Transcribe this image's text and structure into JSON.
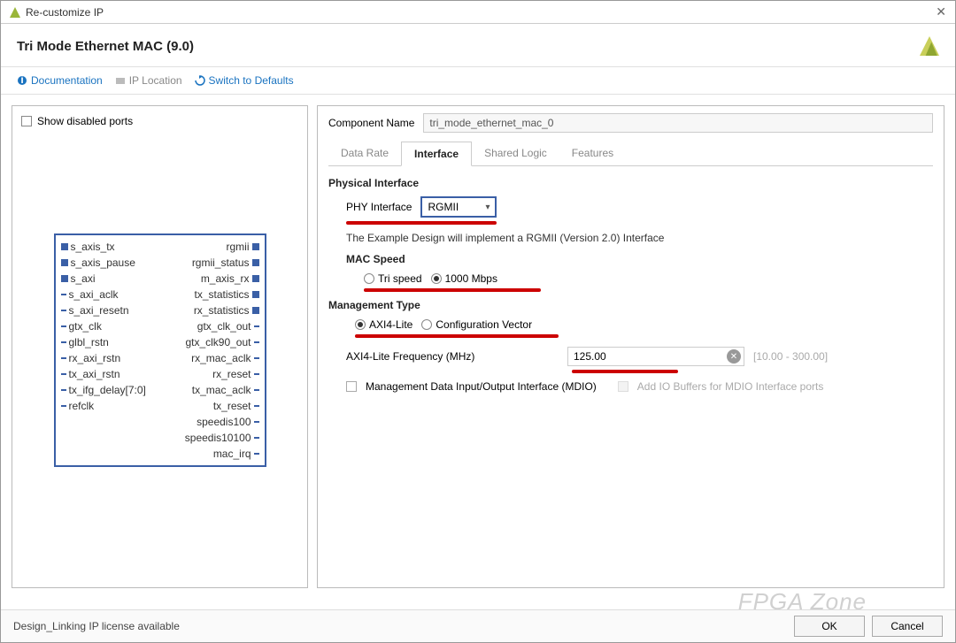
{
  "window": {
    "title": "Re-customize IP"
  },
  "ip": {
    "title": "Tri Mode Ethernet MAC (9.0)"
  },
  "toolbar": {
    "doc": "Documentation",
    "loc": "IP Location",
    "defaults": "Switch to Defaults"
  },
  "left": {
    "show_disabled": "Show disabled ports"
  },
  "ports": {
    "left": [
      "s_axis_tx",
      "s_axis_pause",
      "s_axi",
      "s_axi_aclk",
      "s_axi_resetn",
      "gtx_clk",
      "glbl_rstn",
      "rx_axi_rstn",
      "tx_axi_rstn",
      "tx_ifg_delay[7:0]",
      "refclk"
    ],
    "right": [
      "rgmii",
      "rgmii_status",
      "m_axis_rx",
      "tx_statistics",
      "rx_statistics",
      "gtx_clk_out",
      "gtx_clk90_out",
      "rx_mac_aclk",
      "rx_reset",
      "tx_mac_aclk",
      "tx_reset",
      "speedis100",
      "speedis10100",
      "mac_irq"
    ]
  },
  "right": {
    "comp_label": "Component Name",
    "comp_value": "tri_mode_ethernet_mac_0",
    "tabs": [
      "Data Rate",
      "Interface",
      "Shared Logic",
      "Features"
    ],
    "active_tab": "Interface",
    "phy": {
      "section": "Physical Interface",
      "label": "PHY Interface",
      "value": "RGMII",
      "note": "The Example Design will implement a RGMII (Version 2.0) Interface"
    },
    "mac": {
      "section": "MAC Speed",
      "opt1": "Tri speed",
      "opt2": "1000 Mbps"
    },
    "mgmt": {
      "section": "Management Type",
      "opt1": "AXI4-Lite",
      "opt2": "Configuration Vector",
      "freq_label": "AXI4-Lite Frequency (MHz)",
      "freq_value": "125.00",
      "freq_range": "[10.00 - 300.00]",
      "mdio": "Management Data Input/Output Interface (MDIO)",
      "iobuf": "Add IO Buffers for MDIO Interface ports"
    }
  },
  "footer": {
    "status": "Design_Linking IP license available",
    "ok": "OK",
    "cancel": "Cancel"
  },
  "watermark": "FPGA Zone"
}
